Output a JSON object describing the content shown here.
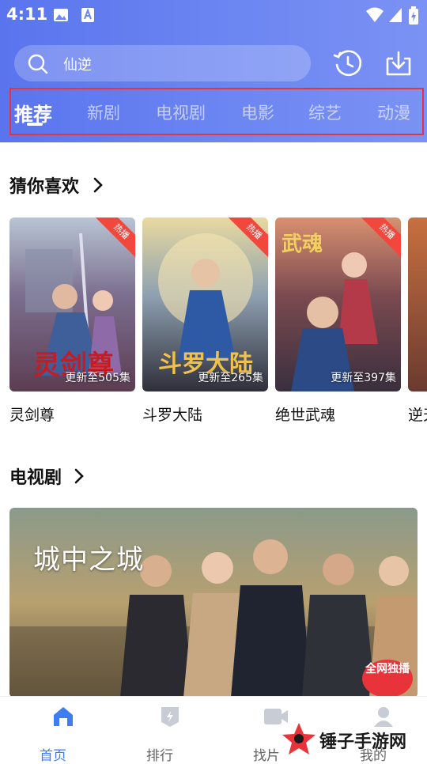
{
  "status_bar": {
    "time": "4:11",
    "icons": [
      "image-icon",
      "text-a-icon",
      "wifi-icon",
      "signal-icon",
      "battery-charging-icon"
    ]
  },
  "search": {
    "placeholder": "仙逆",
    "icon": "search-icon"
  },
  "header_actions": [
    "history-icon",
    "download-icon"
  ],
  "tabs": [
    {
      "label": "推荐",
      "active": true
    },
    {
      "label": "新剧",
      "active": false
    },
    {
      "label": "电视剧",
      "active": false
    },
    {
      "label": "电影",
      "active": false
    },
    {
      "label": "综艺",
      "active": false
    },
    {
      "label": "动漫",
      "active": false
    }
  ],
  "guess": {
    "title": "猜你喜欢",
    "items": [
      {
        "title": "灵剑尊",
        "episodes": "更新至505集",
        "badge": "热播",
        "poster_text": "灵剑尊"
      },
      {
        "title": "斗罗大陆",
        "episodes": "更新至265集",
        "badge": "热播",
        "poster_text": "斗罗大陆"
      },
      {
        "title": "绝世武魂",
        "episodes": "更新至397集",
        "badge": "热播",
        "poster_text": "武魂"
      },
      {
        "title": "逆天",
        "episodes": "",
        "badge": "",
        "poster_text": ""
      }
    ]
  },
  "tv": {
    "title": "电视剧",
    "banner_title": "城中之城",
    "banner_badge": "全网独播"
  },
  "bottom_nav": [
    {
      "label": "首页",
      "icon": "home-icon",
      "active": true
    },
    {
      "label": "排行",
      "icon": "ranking-icon",
      "active": false
    },
    {
      "label": "找片",
      "icon": "find-video-icon",
      "active": false
    },
    {
      "label": "我的",
      "icon": "profile-icon",
      "active": false
    }
  ],
  "watermark": {
    "text": "锤子手游网"
  },
  "colors": {
    "header_gradient_start": "#5a74ee",
    "header_gradient_end": "#7b92f4",
    "highlight_border": "#e5343d",
    "active_nav": "#3d7df2",
    "ribbon": "#f2473d"
  }
}
